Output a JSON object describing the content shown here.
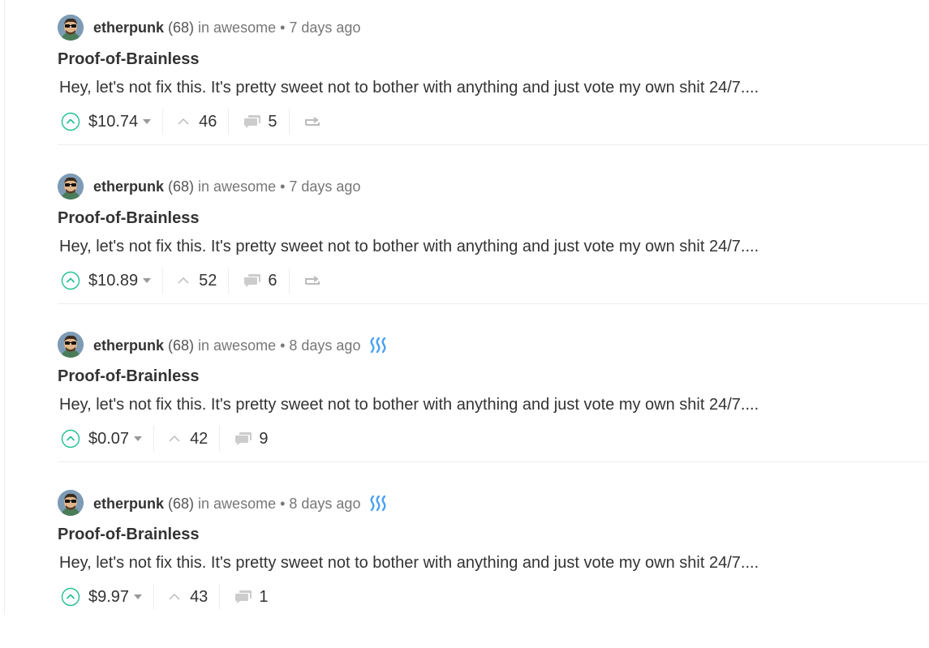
{
  "posts": [
    {
      "author": "etherpunk",
      "reputation": "(68)",
      "category_prefix": "in awesome",
      "separator": "•",
      "age": "7 days ago",
      "title": "Proof-of-Brainless",
      "excerpt": "Hey, let's not fix this. It's pretty sweet not to bother with anything and just vote my own shit 24/7....",
      "payout": "$10.74",
      "votes": "46",
      "comments": "5",
      "show_steem_icon": false,
      "show_reblog": true
    },
    {
      "author": "etherpunk",
      "reputation": "(68)",
      "category_prefix": "in awesome",
      "separator": "•",
      "age": "7 days ago",
      "title": "Proof-of-Brainless",
      "excerpt": "Hey, let's not fix this. It's pretty sweet not to bother with anything and just vote my own shit 24/7....",
      "payout": "$10.89",
      "votes": "52",
      "comments": "6",
      "show_steem_icon": false,
      "show_reblog": true
    },
    {
      "author": "etherpunk",
      "reputation": "(68)",
      "category_prefix": "in awesome",
      "separator": "•",
      "age": "8 days ago",
      "title": "Proof-of-Brainless",
      "excerpt": "Hey, let's not fix this. It's pretty sweet not to bother with anything and just vote my own shit 24/7....",
      "payout": "$0.07",
      "votes": "42",
      "comments": "9",
      "show_steem_icon": true,
      "show_reblog": false
    },
    {
      "author": "etherpunk",
      "reputation": "(68)",
      "category_prefix": "in awesome",
      "separator": "•",
      "age": "8 days ago",
      "title": "Proof-of-Brainless",
      "excerpt": "Hey, let's not fix this. It's pretty sweet not to bother with anything and just vote my own shit 24/7....",
      "payout": "$9.97",
      "votes": "43",
      "comments": "1",
      "show_steem_icon": true,
      "show_reblog": false
    }
  ],
  "colors": {
    "upvote_green": "#1fbf8f",
    "steem_blue": "#4ba2f2",
    "muted_icon": "#cccccc",
    "divider": "#eeeeee"
  },
  "icons": {
    "upvote": "circle-chevron-up-icon",
    "payout_dropdown": "caret-down-icon",
    "votes": "chevron-up-icon",
    "comments": "speech-bubble-icon",
    "reblog": "reblog-icon",
    "steem": "steem-logo-icon"
  }
}
